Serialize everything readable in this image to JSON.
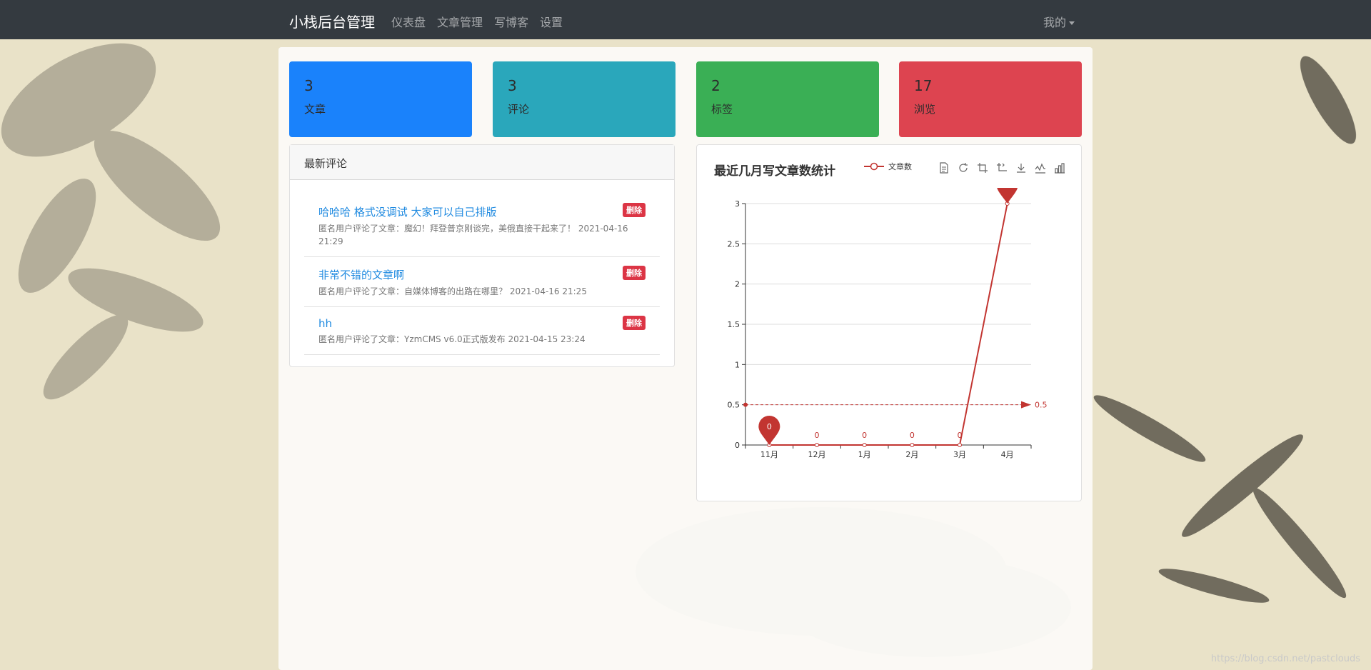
{
  "navbar": {
    "brand": "小栈后台管理",
    "links": [
      "仪表盘",
      "文章管理",
      "写博客",
      "设置"
    ],
    "user_menu": "我的"
  },
  "stats": [
    {
      "value": "3",
      "label": "文章",
      "color": "#1a82fb"
    },
    {
      "value": "3",
      "label": "评论",
      "color": "#2aa7bb"
    },
    {
      "value": "2",
      "label": "标签",
      "color": "#3aaf55"
    },
    {
      "value": "17",
      "label": "浏览",
      "color": "#dd4450"
    }
  ],
  "comments_panel": {
    "title": "最新评论",
    "delete_label": "删除",
    "items": [
      {
        "title": "哈哈哈 格式没调试 大家可以自己排版",
        "meta": "匿名用户评论了文章：魔幻！拜登普京刚谈完，美俄直接干起来了！ 2021-04-16 21:29"
      },
      {
        "title": "非常不错的文章啊",
        "meta": "匿名用户评论了文章：自媒体博客的出路在哪里？ 2021-04-16 21:25"
      },
      {
        "title": "hh",
        "meta": "匿名用户评论了文章：YzmCMS v6.0正式版发布 2021-04-15 23:24"
      }
    ]
  },
  "chart_panel": {
    "title": "最近几月写文章数统计",
    "toolbox_icons": [
      "data-view-icon",
      "restore-icon",
      "zoom-icon",
      "zoom-reset-icon",
      "save-image-icon",
      "line-chart-icon",
      "bar-chart-icon"
    ]
  },
  "chart_data": {
    "type": "line",
    "categories": [
      "11月",
      "12月",
      "1月",
      "2月",
      "3月",
      "4月"
    ],
    "series": [
      {
        "name": "文章数",
        "values": [
          0,
          0,
          0,
          0,
          0,
          3
        ]
      }
    ],
    "ylim": [
      0,
      3
    ],
    "yticks": [
      "0",
      "0.5",
      "1",
      "1.5",
      "2",
      "2.5",
      "3"
    ],
    "markline_average": 0.5,
    "markline_label": "0.5",
    "markpoint_max": "3",
    "markpoint_min": "0",
    "color": "#c23531",
    "grid": true
  },
  "watermark": "https://blog.csdn.net/pastclouds"
}
